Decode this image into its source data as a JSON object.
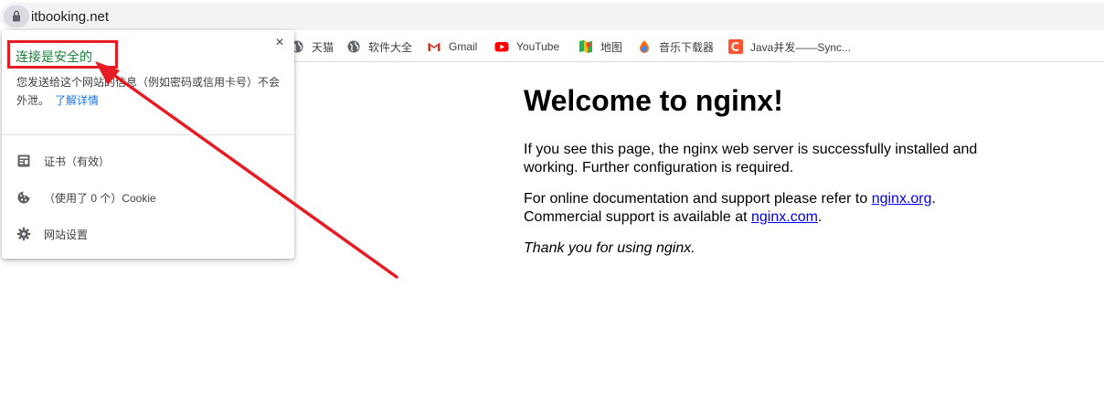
{
  "address_bar": {
    "url": "itbooking.net",
    "lock_icon": "lock-icon"
  },
  "bookmarks": [
    {
      "label": "天猫",
      "icon": "globe-icon"
    },
    {
      "label": "软件大全",
      "icon": "globe-icon"
    },
    {
      "label": "Gmail",
      "icon": "gmail-icon"
    },
    {
      "label": "YouTube",
      "icon": "youtube-icon"
    },
    {
      "label": "地图",
      "icon": "maps-icon"
    },
    {
      "label": "音乐下载器",
      "icon": "music-icon"
    },
    {
      "label": "Java并发——Sync...",
      "icon": "c-logo-icon"
    }
  ],
  "popup": {
    "title": "连接是安全的",
    "description": "您发送给这个网站的信息（例如密码或信用卡号）不会外泄。",
    "learn_more": "了解详情",
    "items": [
      {
        "label": "证书（有效）",
        "icon": "certificate-icon"
      },
      {
        "label": "（使用了 0 个）Cookie",
        "icon": "cookie-icon"
      },
      {
        "label": "网站设置",
        "icon": "gear-icon"
      }
    ],
    "close": "×"
  },
  "page": {
    "heading": "Welcome to nginx!",
    "para1": "If you see this page, the nginx web server is successfully installed and working. Further configuration is required.",
    "para2_prefix": "For online documentation and support please refer to ",
    "link1": "nginx.org",
    "para2_middle": ". Commercial support is available at ",
    "link2": "nginx.com",
    "para2_suffix": ".",
    "para3": "Thank you for using nginx."
  },
  "colors": {
    "secure_green": "#188038",
    "annotation_red": "#e51c23",
    "link_blue": "#0000ee"
  }
}
